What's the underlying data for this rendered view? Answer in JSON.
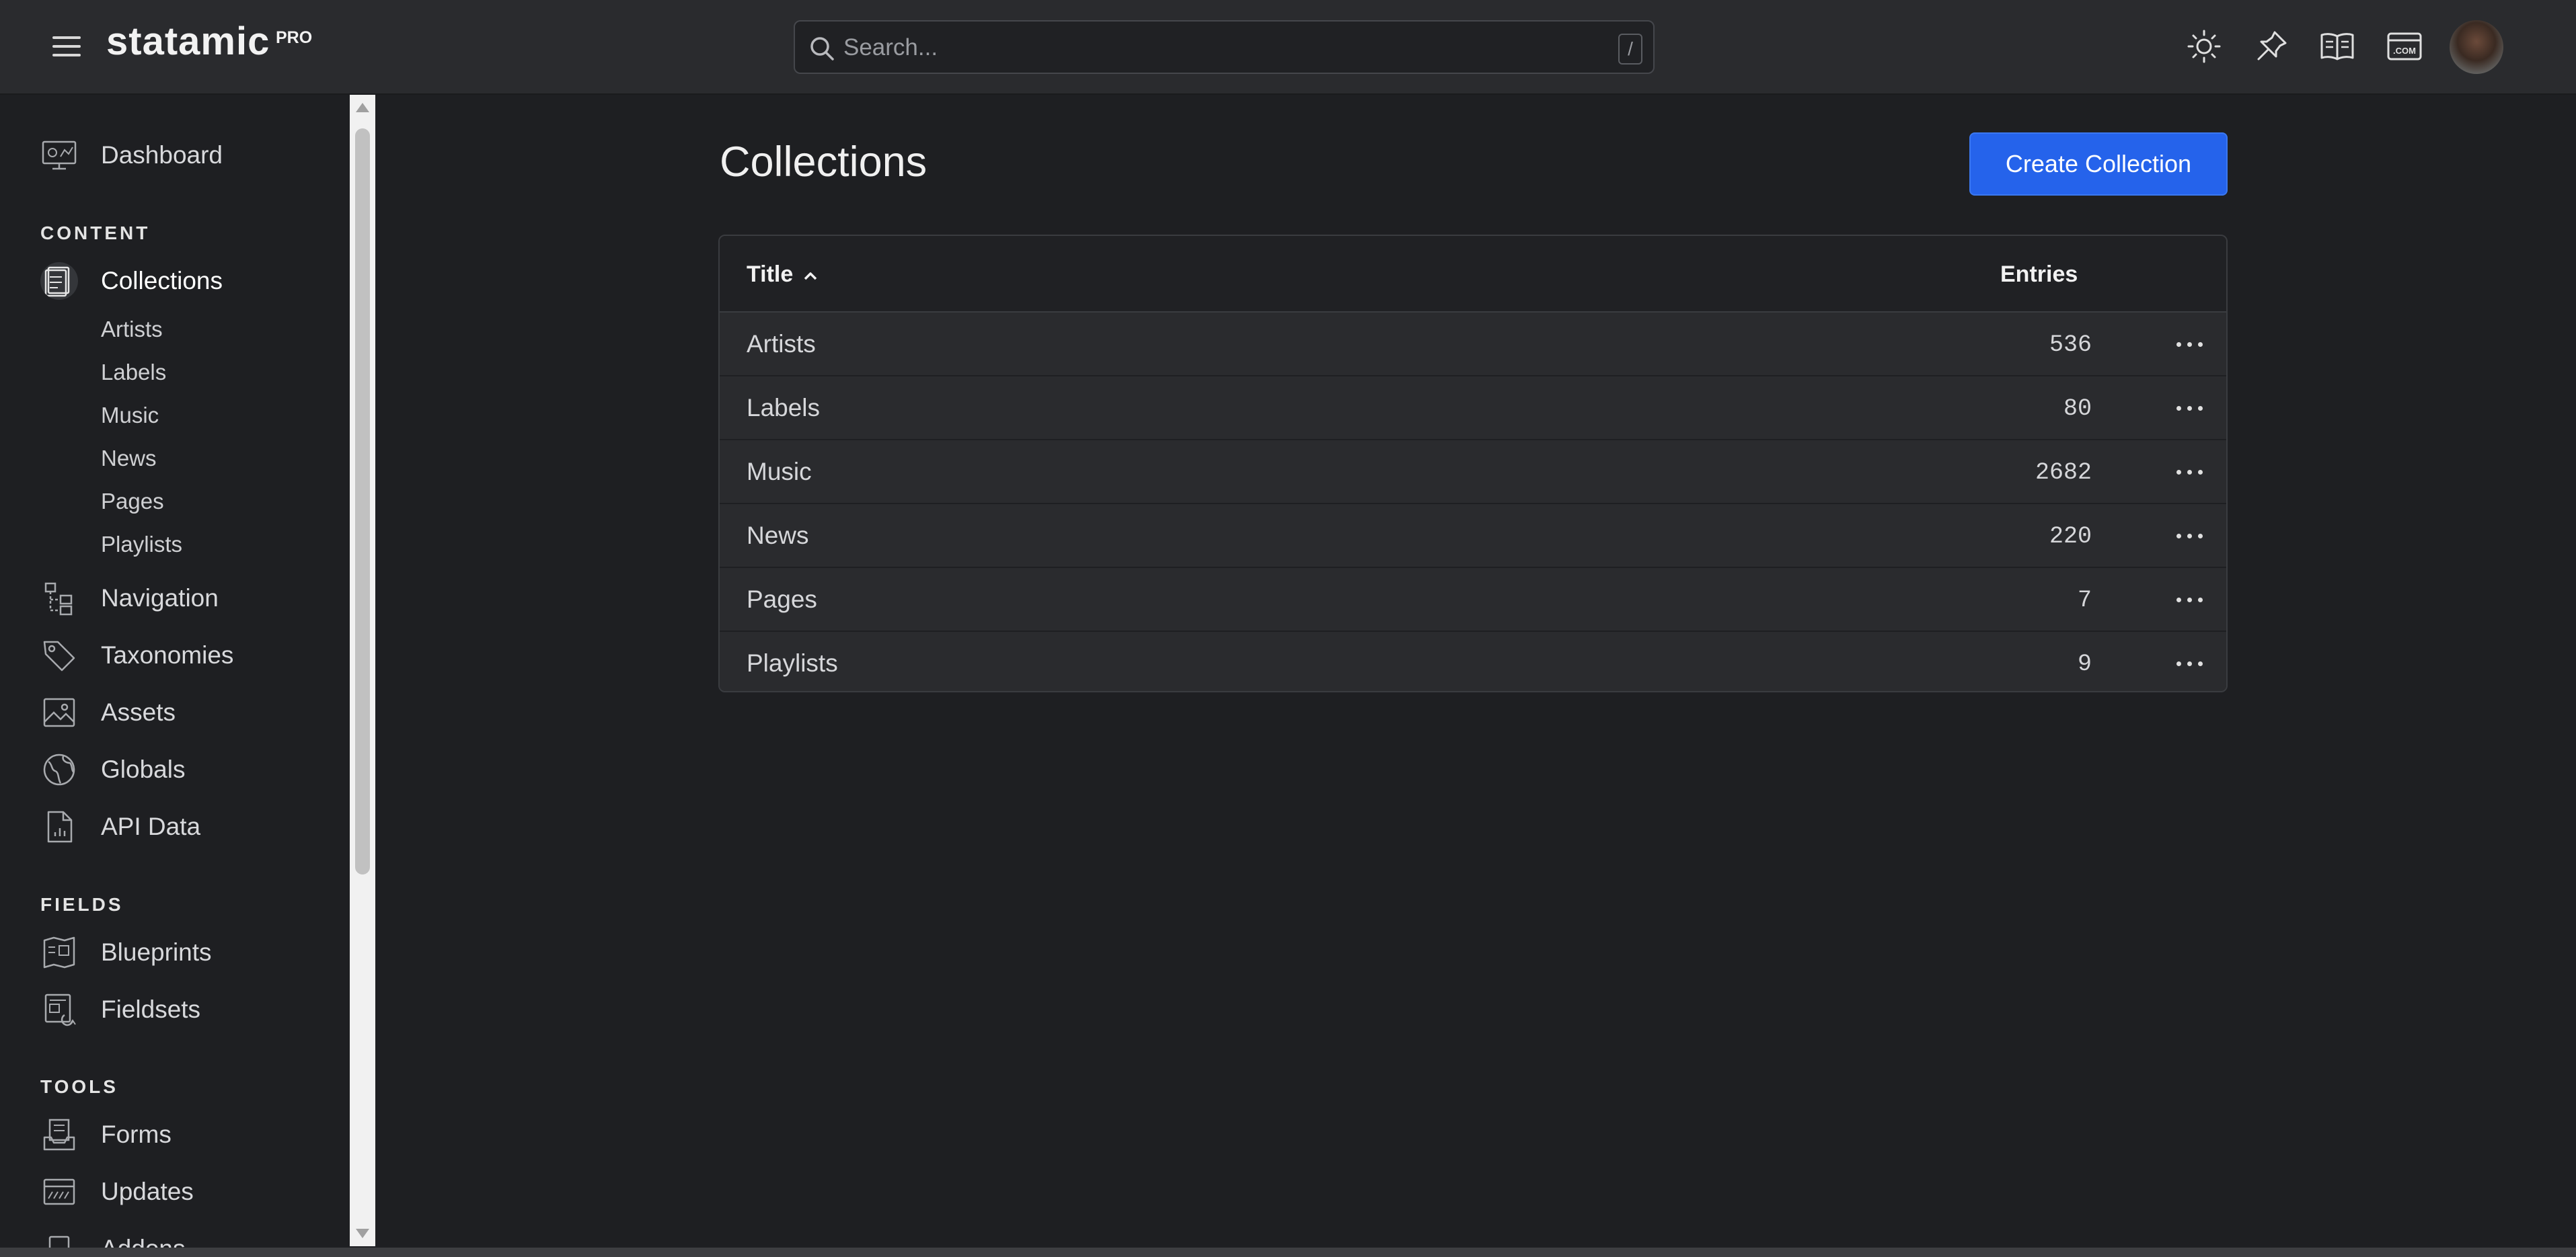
{
  "header": {
    "brand": "statamic",
    "edition": "PRO",
    "search_placeholder": "Search...",
    "search_shortcut": "/",
    "icons": [
      "sun-icon",
      "pin-icon",
      "book-icon",
      "dotcom-icon"
    ]
  },
  "sidebar": {
    "dashboard": "Dashboard",
    "content_title": "CONTENT",
    "collections": "Collections",
    "collection_items": [
      "Artists",
      "Labels",
      "Music",
      "News",
      "Pages",
      "Playlists"
    ],
    "navigation": "Navigation",
    "taxonomies": "Taxonomies",
    "assets": "Assets",
    "globals": "Globals",
    "api_data": "API Data",
    "fields_title": "FIELDS",
    "blueprints": "Blueprints",
    "fieldsets": "Fieldsets",
    "tools_title": "TOOLS",
    "forms": "Forms",
    "updates": "Updates",
    "addons": "Addons"
  },
  "main": {
    "title": "Collections",
    "create_button": "Create Collection",
    "columns": {
      "title": "Title",
      "entries": "Entries"
    },
    "rows": [
      {
        "title": "Artists",
        "entries": "536"
      },
      {
        "title": "Labels",
        "entries": "80"
      },
      {
        "title": "Music",
        "entries": "2682"
      },
      {
        "title": "News",
        "entries": "220"
      },
      {
        "title": "Pages",
        "entries": "7"
      },
      {
        "title": "Playlists",
        "entries": "9"
      }
    ]
  },
  "colors": {
    "accent": "#2563eb",
    "background": "#1e1f22",
    "topbar": "#2a2b2e"
  }
}
